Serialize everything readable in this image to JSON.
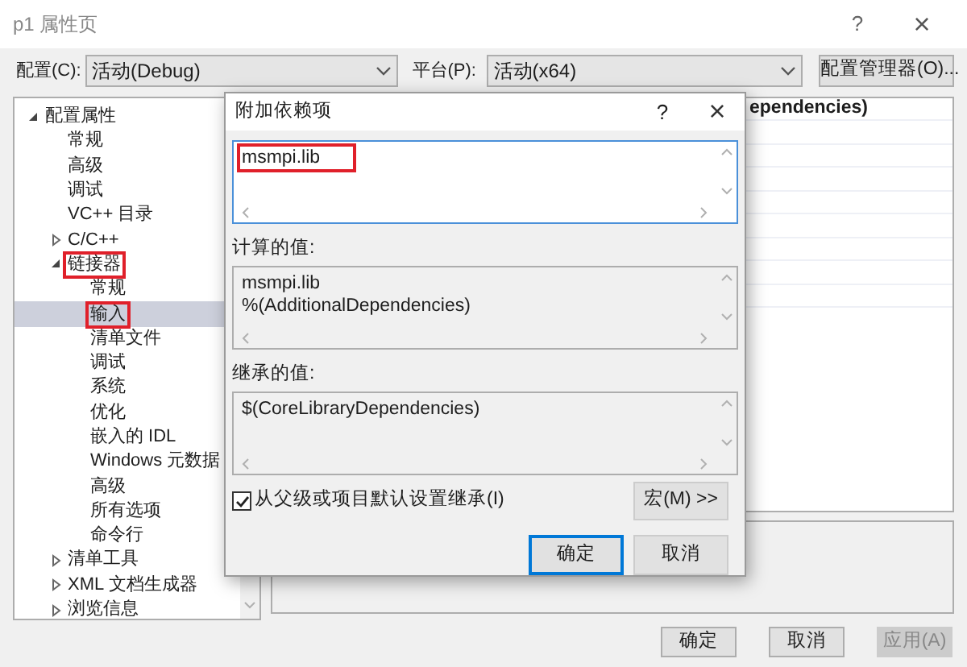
{
  "window": {
    "title": "p1 属性页"
  },
  "config_bar": {
    "configuration_label": "配置(C):",
    "configuration_value": "活动(Debug)",
    "platform_label": "平台(P):",
    "platform_value": "活动(x64)",
    "manager_button": "配置管理器(O)..."
  },
  "tree": [
    {
      "label": "配置属性",
      "expanded": true,
      "marked": false,
      "selected": false,
      "children": [
        {
          "label": "常规",
          "marked": false,
          "selected": false
        },
        {
          "label": "高级",
          "marked": false,
          "selected": false
        },
        {
          "label": "调试",
          "marked": false,
          "selected": false
        },
        {
          "label": "VC++ 目录",
          "marked": false,
          "selected": false
        },
        {
          "label": "C/C++",
          "expanded": false,
          "marked": false,
          "selected": false
        },
        {
          "label": "链接器",
          "expanded": true,
          "marked": true,
          "selected": false,
          "children": [
            {
              "label": "常规",
              "marked": false,
              "selected": false
            },
            {
              "label": "输入",
              "marked": true,
              "selected": true
            },
            {
              "label": "清单文件",
              "marked": false,
              "selected": false
            },
            {
              "label": "调试",
              "marked": false,
              "selected": false
            },
            {
              "label": "系统",
              "marked": false,
              "selected": false
            },
            {
              "label": "优化",
              "marked": false,
              "selected": false
            },
            {
              "label": "嵌入的 IDL",
              "marked": false,
              "selected": false
            },
            {
              "label": "Windows 元数据",
              "marked": false,
              "selected": false
            },
            {
              "label": "高级",
              "marked": false,
              "selected": false
            },
            {
              "label": "所有选项",
              "marked": false,
              "selected": false
            },
            {
              "label": "命令行",
              "marked": false,
              "selected": false
            }
          ]
        },
        {
          "label": "清单工具",
          "expanded": false,
          "marked": false,
          "selected": false
        },
        {
          "label": "XML 文档生成器",
          "expanded": false,
          "marked": false,
          "selected": false
        },
        {
          "label": "浏览信息",
          "expanded": false,
          "marked": false,
          "selected": false
        }
      ]
    }
  ],
  "property_grid": {
    "visible_text": "ependencies)"
  },
  "buttons": [
    {
      "label": "确定",
      "disabled": false
    },
    {
      "label": "取消",
      "disabled": false
    },
    {
      "label": "应用(A)",
      "disabled": true
    }
  ],
  "dialog": {
    "title": "附加依赖项",
    "help": "?",
    "close": "×",
    "edit_value": "msmpi.lib",
    "edit_marked": true,
    "computed_label": "计算的值:",
    "computed_lines": [
      "msmpi.lib",
      "%(AdditionalDependencies)"
    ],
    "inherited_label": "继承的值:",
    "inherited_lines": [
      "$(CoreLibraryDependencies)"
    ],
    "inherit_checkbox": {
      "label": "从父级或项目默认设置继承(I)",
      "checked": true
    },
    "macro_button": "宏(M) >>",
    "ok_button": "确定",
    "cancel_button": "取消"
  },
  "window_help": "?",
  "window_close": "×"
}
